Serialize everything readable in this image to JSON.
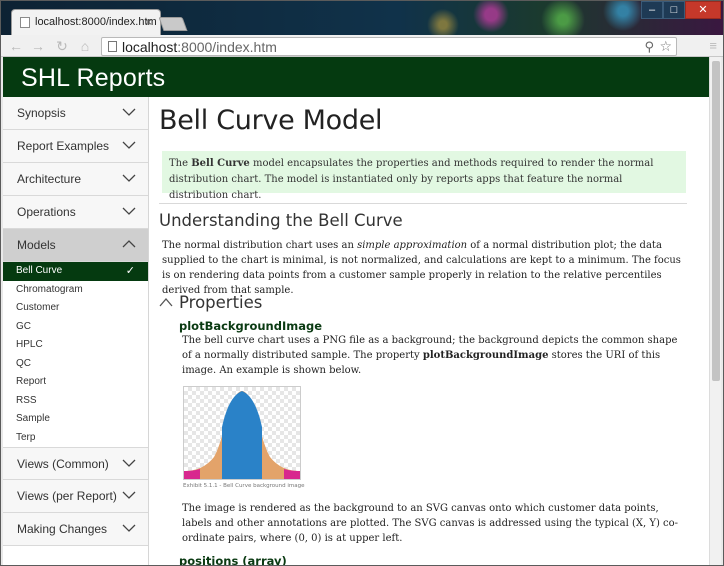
{
  "browser": {
    "tab_title": "localhost:8000/index.htm",
    "tab_close": "×",
    "url_host": "localhost",
    "url_path": ":8000/index.htm",
    "window_controls": [
      "–",
      "□",
      "✕"
    ]
  },
  "site": {
    "title": "SHL Reports",
    "header_color": "#053a10"
  },
  "sidebar": {
    "sections": [
      {
        "label": "Synopsis",
        "state": "collapsed"
      },
      {
        "label": "Report Examples",
        "state": "collapsed"
      },
      {
        "label": "Architecture",
        "state": "collapsed"
      },
      {
        "label": "Operations",
        "state": "collapsed"
      },
      {
        "label": "Models",
        "state": "expanded"
      },
      {
        "label": "Views (Common)",
        "state": "collapsed"
      },
      {
        "label": "Views (per Report)",
        "state": "collapsed"
      },
      {
        "label": "Making Changes",
        "state": "collapsed"
      }
    ],
    "models_items": [
      {
        "label": "Bell Curve",
        "active": true
      },
      {
        "label": "Chromatogram"
      },
      {
        "label": "Customer"
      },
      {
        "label": "GC"
      },
      {
        "label": "HPLC"
      },
      {
        "label": "QC"
      },
      {
        "label": "Report"
      },
      {
        "label": "RSS"
      },
      {
        "label": "Sample"
      },
      {
        "label": "Terp"
      }
    ],
    "active_check": "✓"
  },
  "content": {
    "title": "Bell Curve Model",
    "notice": {
      "pre": "The ",
      "bold": "Bell Curve",
      "post": " model encapsulates the properties and methods required to render the normal distribution  chart. The model is instantiated only by reports apps that feature the normal distribution chart."
    },
    "section_heading": "Understanding the Bell Curve",
    "para1": {
      "pre": "The normal distribution chart uses an ",
      "em": "simple approximation",
      "post": " of a normal distribution plot; the data supplied to the chart is minimal, is not normalized, and calculations are kept to a minimum. The focus is on rendering data points from a customer sample properly in relation to the relative percentiles derived from that sample."
    },
    "properties_heading": "Properties",
    "prop1_name": "plotBackgroundImage",
    "para2": {
      "pre": "The bell curve chart uses a PNG file as a background; the background depicts the common shape of a normally distributed sample. The property ",
      "bold": "plotBackgroundImage",
      "post": " stores the URI of this image. An example is shown below."
    },
    "exhibit_caption": "Exhibit 5.1.1 - Bell Curve background image",
    "para3": "The image is rendered as the background to an SVG canvas onto which customer data points, labels and other annotations are plotted. The SVG canvas is addressed using the typical (X, Y) co-ordinate pairs, where (0, 0) is at upper left.",
    "next_heading": "positions (array)"
  }
}
